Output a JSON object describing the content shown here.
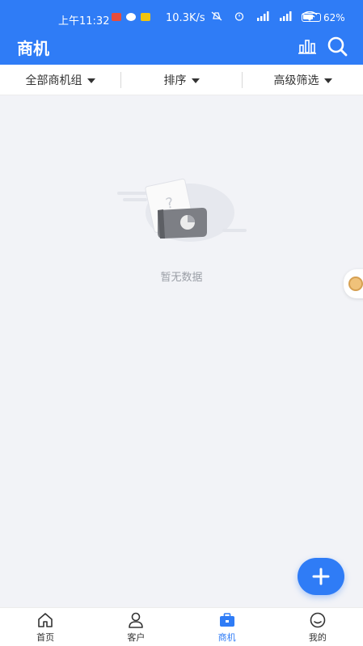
{
  "status_bar": {
    "time": "上午11:32",
    "net_speed": "10.3K/s",
    "battery": "62%"
  },
  "header": {
    "title": "商机",
    "stats_icon": "bar-chart-icon",
    "search_icon": "search-icon"
  },
  "filters": [
    {
      "label": "全部商机组"
    },
    {
      "label": "排序"
    },
    {
      "label": "高级筛选"
    }
  ],
  "empty_state": {
    "text": "暂无数据"
  },
  "fab": {
    "icon": "plus-icon"
  },
  "tabs": [
    {
      "label": "首页",
      "icon": "home-icon"
    },
    {
      "label": "客户",
      "icon": "user-icon"
    },
    {
      "label": "商机",
      "icon": "briefcase-icon",
      "active": true
    },
    {
      "label": "我的",
      "icon": "smiley-icon"
    }
  ],
  "colors": {
    "primary": "#2f7cf6",
    "background": "#f2f3f7",
    "muted_text": "#9a9ea6"
  }
}
